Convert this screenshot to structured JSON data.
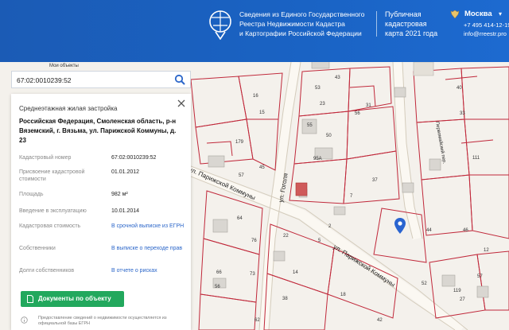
{
  "header": {
    "org_line1": "Сведения из Единого Государственного",
    "org_line2": "Реестра Недвижимости Кадастра",
    "org_line3": "и Картографии Российской Федерации",
    "product_line1": "Публичная",
    "product_line2": "кадастровая",
    "product_line3": "карта 2021 года",
    "city": "Москва",
    "phone": "+7 495 414-12-19",
    "email": "info@rreestr.pro"
  },
  "search": {
    "value": "67:02:0010239:52"
  },
  "panel": {
    "type": "Среднеэтажная жилая застройка",
    "address": "Российская Федерация, Смоленская область, р-н Вяземский, г. Вязьма, ул. Парижской Коммуны, д. 23",
    "rows": [
      {
        "label": "Кадастровый номер",
        "value": "67:02:0010239:52"
      },
      {
        "label": "Присвоение кадастровой стоимости",
        "value": "01.01.2012"
      },
      {
        "label": "Площадь",
        "value": "982 м²"
      },
      {
        "label": "Введение в эксплуатацию",
        "value": "10.01.2014"
      },
      {
        "label": "Кадастровая стоимость",
        "value": "В срочной выписке из ЕГРН"
      },
      {
        "label": "Собственники",
        "value": "В выписке о переходе прав"
      },
      {
        "label": "Долги собственников",
        "value": "В отчете о рисках"
      }
    ],
    "docs_button": "Документы по объекту",
    "disclaimer": "Предоставление сведений о недвижимости осуществляется из официальной базы ЕГРН"
  },
  "map": {
    "my_label": "Мои объекты",
    "streets": {
      "parizhskoy_1": "ул. Парижской Коммуны",
      "parizhskoy_2": "ул. Парижской Коммуны",
      "gogolya": "ул. Гоголя",
      "pervomaysky": "Первомайский пер."
    },
    "parcel_numbers": [
      "43",
      "53",
      "56",
      "23",
      "15",
      "55",
      "50",
      "179",
      "45",
      "57",
      "95А",
      "37",
      "7",
      "64",
      "22",
      "2",
      "76",
      "73",
      "5",
      "14",
      "56",
      "38",
      "18",
      "44",
      "46",
      "52",
      "111",
      "12",
      "57",
      "119",
      "27",
      "42",
      "62",
      "16",
      "31",
      "66",
      "40",
      "33"
    ]
  },
  "colors": {
    "header": "#1b5bb5",
    "button": "#22a85d",
    "link": "#2b66c9",
    "parcel": "#c0283a"
  }
}
